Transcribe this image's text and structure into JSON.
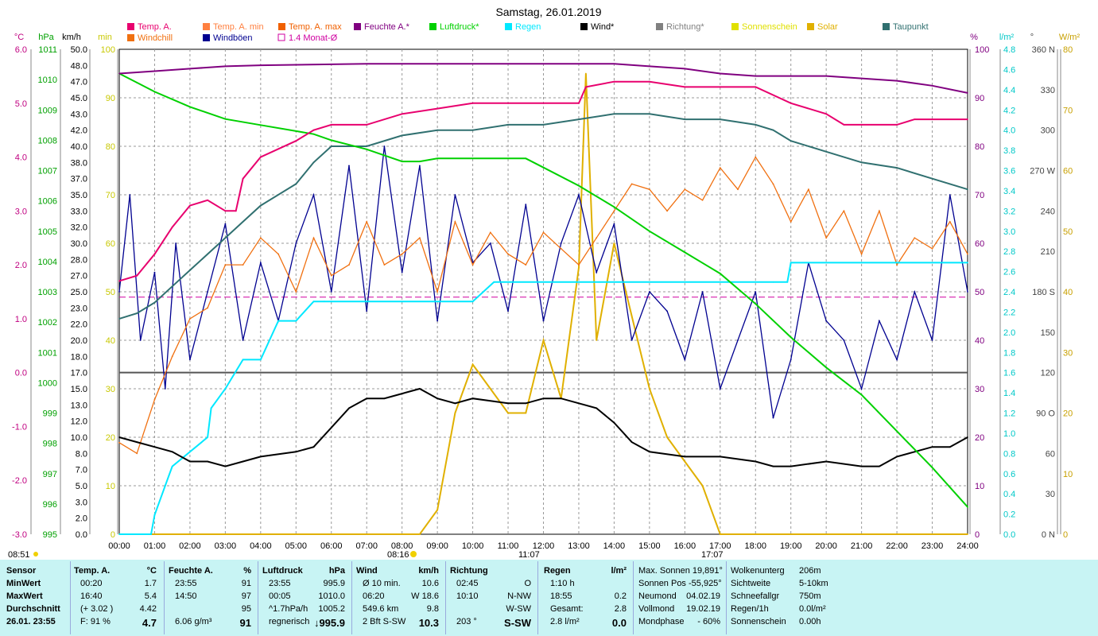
{
  "title": "Samstag, 26.01.2019",
  "colors": {
    "temp": "#e8006e",
    "temp_min": "#ff8040",
    "temp_max": "#f06000",
    "feuchte": "#800080",
    "luftdruck": "#00d000",
    "regen": "#00e8ff",
    "wind": "#000000",
    "richtung": "#808080",
    "sonnenschein": "#e0e000",
    "solar": "#e0b000",
    "taupunkt": "#307070",
    "windchill": "#f07010",
    "windboeen": "#000090",
    "monat": "#d000a0",
    "footer_bg": "#c8f4f4"
  },
  "legend": [
    {
      "label": "Temp. A.",
      "color": "#e8006e",
      "kind": "box"
    },
    {
      "label": "Temp. A. min",
      "color": "#ff8040",
      "kind": "box"
    },
    {
      "label": "Temp. A. max",
      "color": "#f06000",
      "kind": "box"
    },
    {
      "label": "Feuchte A.*",
      "color": "#800080",
      "kind": "box"
    },
    {
      "label": "Luftdruck*",
      "color": "#00d000",
      "kind": "box"
    },
    {
      "label": "Regen",
      "color": "#00e8ff",
      "kind": "box"
    },
    {
      "label": "Wind*",
      "color": "#000000",
      "kind": "box"
    },
    {
      "label": "Richtung*",
      "color": "#808080",
      "kind": "box"
    },
    {
      "label": "Sonnenschein",
      "color": "#e0e000",
      "kind": "box"
    },
    {
      "label": "Solar",
      "color": "#e0b000",
      "kind": "box"
    },
    {
      "label": "Taupunkt",
      "color": "#307070",
      "kind": "box"
    },
    {
      "label": "Windchill",
      "color": "#f07010",
      "kind": "box"
    },
    {
      "label": "Windböen",
      "color": "#000090",
      "kind": "box"
    },
    {
      "label": "1.4 Monat-Ø",
      "color": "#d000a0",
      "kind": "hollow"
    }
  ],
  "axes": {
    "temp_c": {
      "unit": "°C",
      "ticks": [
        "6.0",
        "5.0",
        "4.0",
        "3.0",
        "2.0",
        "1.0",
        "0.0",
        "-1.0",
        "-2.0",
        "-3.0"
      ]
    },
    "hpa": {
      "unit": "hPa",
      "ticks": [
        "1011",
        "1010",
        "1009",
        "1008",
        "1007",
        "1006",
        "1005",
        "1004",
        "1003",
        "1002",
        "1001",
        "1000",
        "999",
        "998",
        "997",
        "996",
        "995"
      ]
    },
    "kmh": {
      "unit": "km/h",
      "ticks": [
        "50.0",
        "48.0",
        "47.0",
        "45.0",
        "43.0",
        "42.0",
        "40.0",
        "38.0",
        "37.0",
        "35.0",
        "33.0",
        "32.0",
        "30.0",
        "28.0",
        "27.0",
        "25.0",
        "23.0",
        "22.0",
        "20.0",
        "18.0",
        "17.0",
        "15.0",
        "13.0",
        "12.0",
        "10.0",
        "8.0",
        "7.0",
        "5.0",
        "3.0",
        "2.0",
        "0.0"
      ]
    },
    "min": {
      "unit": "min",
      "ticks": [
        "100",
        "90",
        "80",
        "70",
        "60",
        "50",
        "40",
        "30",
        "20",
        "10",
        "0"
      ]
    },
    "pct": {
      "unit": "%",
      "ticks": [
        "100",
        "90",
        "80",
        "70",
        "60",
        "50",
        "40",
        "30",
        "20",
        "10",
        "0"
      ]
    },
    "rain": {
      "unit": "l/m²",
      "ticks": [
        "4.8",
        "4.6",
        "4.4",
        "4.2",
        "4.0",
        "3.8",
        "3.6",
        "3.4",
        "3.2",
        "3.0",
        "2.8",
        "2.6",
        "2.4",
        "2.2",
        "2.0",
        "1.8",
        "1.6",
        "1.4",
        "1.2",
        "1.0",
        "0.8",
        "0.6",
        "0.4",
        "0.2",
        "0.0"
      ]
    },
    "deg": {
      "unit": "°",
      "ticks": [
        "360 N",
        "330",
        "300",
        "270 W",
        "240",
        "210",
        "180 S",
        "150",
        "120",
        "90 O",
        "60",
        "30",
        "0 N"
      ]
    },
    "wm2": {
      "unit": "W/m²",
      "ticks": [
        "80",
        "70",
        "60",
        "50",
        "40",
        "30",
        "20",
        "10",
        "0"
      ]
    }
  },
  "time_ticks": [
    "00:00",
    "01:00",
    "02:00",
    "03:00",
    "04:00",
    "05:00",
    "06:00",
    "07:00",
    "08:00",
    "09:00",
    "10:00",
    "11:00",
    "12:00",
    "13:00",
    "14:00",
    "15:00",
    "16:00",
    "17:00",
    "18:00",
    "19:00",
    "20:00",
    "21:00",
    "22:00",
    "23:00",
    "24:00"
  ],
  "sun_markers": {
    "left": "08:51",
    "sunrise": "08:16",
    "noon": "11:07",
    "sunset": "17:07"
  },
  "chart_data": {
    "type": "line",
    "title": "Samstag, 26.01.2019",
    "x_unit": "hours",
    "series": [
      {
        "name": "Feuchte A.*",
        "axis": "%",
        "x": [
          0,
          1,
          2,
          3,
          4,
          5,
          6,
          7,
          8,
          9,
          10,
          11,
          12,
          13,
          14,
          15,
          16,
          17,
          18,
          19,
          20,
          21,
          22,
          23,
          24
        ],
        "values": [
          95,
          95.5,
          96,
          96.5,
          96.7,
          96.8,
          96.9,
          97,
          97,
          97,
          97,
          97,
          97,
          97,
          97,
          96.5,
          96,
          95,
          94.5,
          94.5,
          94.5,
          94,
          93.5,
          92.5,
          91
        ]
      },
      {
        "name": "Luftdruck*",
        "axis": "hPa",
        "x": [
          0,
          0.5,
          1,
          2,
          3,
          4,
          5,
          5.5,
          6,
          7,
          8,
          8.5,
          9,
          10,
          11,
          11.5,
          12,
          13,
          14,
          15,
          16,
          17,
          18,
          19,
          20,
          21,
          22,
          23,
          24
        ],
        "values": [
          1010.2,
          1009.9,
          1009.6,
          1009.1,
          1008.7,
          1008.5,
          1008.3,
          1008.2,
          1008,
          1007.7,
          1007.3,
          1007.3,
          1007.4,
          1007.4,
          1007.4,
          1007.4,
          1007.1,
          1006.5,
          1005.8,
          1005,
          1004.3,
          1003.6,
          1002.6,
          1001.5,
          1000.5,
          999.6,
          998.4,
          997.2,
          995.9
        ]
      },
      {
        "name": "Taupunkt",
        "axis": "°C",
        "x": [
          0,
          0.5,
          1,
          1.5,
          2,
          2.5,
          3,
          3.5,
          4,
          5,
          5.5,
          6,
          7,
          8,
          9,
          10,
          11,
          12,
          13,
          14,
          15,
          16,
          17,
          18,
          18.5,
          19,
          20,
          21,
          22,
          23,
          23.5,
          24
        ],
        "values": [
          1.0,
          1.1,
          1.3,
          1.6,
          1.9,
          2.2,
          2.5,
          2.8,
          3.1,
          3.5,
          3.9,
          4.2,
          4.2,
          4.4,
          4.5,
          4.5,
          4.6,
          4.6,
          4.7,
          4.8,
          4.8,
          4.7,
          4.7,
          4.6,
          4.5,
          4.3,
          4.1,
          3.9,
          3.8,
          3.6,
          3.5,
          3.4
        ]
      },
      {
        "name": "Temp. A.",
        "axis": "°C",
        "x": [
          0,
          0.5,
          1,
          1.5,
          2,
          2.5,
          3,
          3.3,
          3.5,
          4,
          5,
          5.5,
          6,
          7,
          8,
          9,
          10,
          11,
          12,
          13,
          13.2,
          14,
          15,
          16,
          17,
          18,
          19,
          20,
          20.5,
          21,
          22,
          22.5,
          23,
          24
        ],
        "values": [
          1.7,
          1.8,
          2.2,
          2.7,
          3.1,
          3.2,
          3.0,
          3.0,
          3.6,
          4.0,
          4.3,
          4.5,
          4.6,
          4.6,
          4.8,
          4.9,
          5.0,
          5.0,
          5.0,
          5.0,
          5.3,
          5.4,
          5.4,
          5.3,
          5.3,
          5.3,
          5.0,
          4.8,
          4.6,
          4.6,
          4.6,
          4.7,
          4.7,
          4.7
        ]
      },
      {
        "name": "Wind*",
        "axis": "km/h",
        "x": [
          0,
          0.5,
          1,
          1.5,
          2,
          2.5,
          3,
          3.5,
          4,
          5,
          5.5,
          6,
          6.5,
          7,
          7.5,
          8,
          8.5,
          9,
          9.5,
          10,
          11,
          11.5,
          12,
          12.5,
          13,
          13.5,
          14,
          14.5,
          15,
          16,
          17,
          18,
          18.5,
          19,
          20,
          21,
          21.5,
          22,
          22.5,
          23,
          23.5,
          24
        ],
        "values": [
          10,
          9.5,
          9,
          8.5,
          7.5,
          7.5,
          7,
          7.5,
          8,
          8.5,
          9,
          11,
          13,
          14,
          14,
          14.5,
          15,
          14,
          13.5,
          14,
          13.5,
          13.5,
          14,
          14,
          13.5,
          13,
          11.5,
          9.5,
          8.5,
          8,
          8,
          7.5,
          7,
          7,
          7.5,
          7,
          7,
          8,
          8.5,
          9,
          9,
          10
        ]
      },
      {
        "name": "Windböen",
        "axis": "km/h",
        "x": [
          0,
          0.3,
          0.6,
          1,
          1.3,
          1.6,
          2,
          2.5,
          3,
          3.5,
          4,
          4.5,
          5,
          5.5,
          6,
          6.5,
          7,
          7.5,
          8,
          8.5,
          9,
          9.5,
          10,
          10.5,
          11,
          11.5,
          12,
          12.5,
          13,
          13.5,
          14,
          14.5,
          15,
          15.5,
          16,
          16.5,
          17,
          17.5,
          18,
          18.5,
          19,
          19.5,
          20,
          20.5,
          21,
          21.5,
          22,
          22.5,
          23,
          23.5,
          24
        ],
        "values": [
          25,
          35,
          20,
          27,
          15,
          30,
          18,
          25,
          32,
          20,
          28,
          22,
          30,
          35,
          25,
          38,
          23,
          40,
          27,
          38,
          22,
          35,
          28,
          30,
          23,
          34,
          22,
          30,
          35,
          27,
          32,
          20,
          25,
          23,
          18,
          25,
          15,
          20,
          25,
          12,
          18,
          28,
          22,
          20,
          15,
          22,
          18,
          25,
          20,
          35,
          25
        ]
      },
      {
        "name": "Windchill",
        "axis": "°C",
        "x": [
          0,
          0.5,
          1,
          1.5,
          2,
          2.5,
          3,
          3.5,
          4,
          4.5,
          5,
          5.5,
          6,
          6.5,
          7,
          7.5,
          8,
          8.5,
          9,
          9.5,
          10,
          10.5,
          11,
          11.5,
          12,
          12.5,
          13,
          13.5,
          14,
          14.5,
          15,
          15.5,
          16,
          16.5,
          17,
          17.5,
          18,
          18.5,
          19,
          19.5,
          20,
          20.5,
          21,
          21.5,
          22,
          22.5,
          23,
          23.5,
          24
        ],
        "values": [
          -1.3,
          -1.5,
          -0.5,
          0.3,
          1.0,
          1.2,
          2.0,
          2.0,
          2.5,
          2.2,
          1.5,
          2.5,
          1.8,
          2.0,
          2.8,
          2.0,
          2.2,
          2.5,
          1.5,
          2.8,
          2.0,
          2.6,
          2.2,
          2.0,
          2.6,
          2.3,
          2.0,
          2.5,
          3.0,
          3.5,
          3.4,
          3.0,
          3.4,
          3.2,
          3.8,
          3.4,
          4.0,
          3.5,
          2.8,
          3.4,
          2.5,
          3.0,
          2.2,
          3.0,
          2.0,
          2.5,
          2.3,
          2.8,
          2.2
        ]
      },
      {
        "name": "Sonnenschein",
        "axis": "min",
        "x": [
          0,
          8.5,
          9,
          9.5,
          10,
          10.5,
          11,
          11.5,
          12,
          12.5,
          13,
          13.2,
          13.5,
          14,
          14.5,
          15,
          15.5,
          16,
          16.5,
          17,
          24
        ],
        "values": [
          0,
          0,
          5,
          25,
          35,
          30,
          25,
          25,
          40,
          28,
          55,
          95,
          40,
          60,
          45,
          30,
          20,
          15,
          10,
          0,
          0
        ]
      },
      {
        "name": "Regen",
        "axis": "l/m²",
        "x": [
          0,
          0.9,
          1,
          1.4,
          1.5,
          2.5,
          2.6,
          3,
          3.5,
          4,
          4.5,
          5,
          5.5,
          5.8,
          6,
          10,
          10.6,
          11,
          18.5,
          18.9,
          19,
          24
        ],
        "values": [
          0,
          0,
          0.2,
          0.6,
          0.7,
          1.0,
          1.3,
          1.5,
          1.8,
          1.8,
          2.2,
          2.2,
          2.4,
          2.4,
          2.4,
          2.4,
          2.6,
          2.6,
          2.6,
          2.6,
          2.8,
          2.8
        ]
      }
    ],
    "reference_line": {
      "name": "1.4 Monat-Ø",
      "value": 1.4,
      "axis": "°C"
    }
  },
  "footer": {
    "sensor": {
      "h": "Sensor",
      "rows": [
        "MinWert",
        "MaxWert",
        "Durchschnitt",
        "26.01. 23:55"
      ]
    },
    "temp": {
      "h": "Temp. A.",
      "u": "°C",
      "t": [
        "00:20",
        "16:40",
        "(+ 3.02 )",
        "F: 91 %"
      ],
      "v": [
        "1.7",
        "5.4",
        "4.42",
        "4.7"
      ]
    },
    "feuchte": {
      "h": "Feuchte A.",
      "u": "%",
      "t": [
        "23:55",
        "14:50",
        "",
        "6.06 g/m³"
      ],
      "v": [
        "91",
        "97",
        "95",
        "91"
      ]
    },
    "luftdruck": {
      "h": "Luftdruck",
      "u": "hPa",
      "t": [
        "23:55",
        "00:05",
        "^1.7hPa/h",
        "regnerisch"
      ],
      "v": [
        "995.9",
        "1010.0",
        "1005.2",
        "↓995.9"
      ]
    },
    "wind": {
      "h": "Wind",
      "u": "km/h",
      "t": [
        "Ø 10 min.",
        "06:20",
        "549.6 km",
        "2 Bft S-SW"
      ],
      "v": [
        "10.6",
        "W 18.6",
        "9.8",
        "10.3"
      ]
    },
    "richtung": {
      "h": "Richtung",
      "t": [
        "02:45",
        "10:10",
        "",
        "203 °"
      ],
      "v": [
        "O",
        "N-NW",
        "W-SW",
        "S-SW"
      ]
    },
    "regen": {
      "h": "Regen",
      "u": "l/m²",
      "t": [
        "1:10 h",
        "18:55",
        "Gesamt:",
        "2.8 l/m²"
      ],
      "v": [
        "",
        "0.2",
        "2.8",
        "0.0"
      ]
    },
    "astro": {
      "t": [
        "Max. Sonnen 19,891°",
        "Sonnen Pos -55,925°",
        "Neumond",
        "Vollmond",
        "Mondphase"
      ],
      "v": [
        "",
        "",
        "04.02.19",
        "19.02.19",
        "- 60%"
      ]
    },
    "misc": {
      "t": [
        "Wolkenunterg",
        "Sichtweite",
        "Schneefallgr",
        "Regen/1h",
        "Sonnenschein"
      ],
      "v": [
        "206m",
        "5-10km",
        "750m",
        "0.0l/m²",
        "0.00h"
      ]
    }
  }
}
